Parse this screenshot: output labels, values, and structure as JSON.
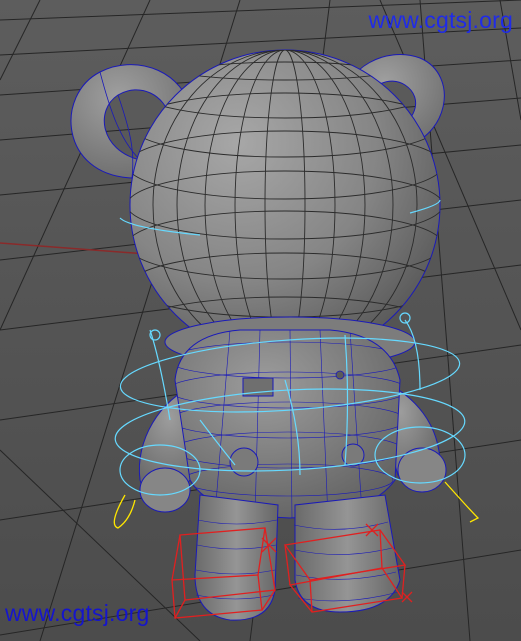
{
  "viewport": {
    "watermark_top": "www.cgtsj.org",
    "watermark_bottom": "www.cgtsj.org"
  },
  "colors": {
    "grid": "#262626",
    "mesh_body": "#8a8a8a",
    "wireframe": "#1a1ab8",
    "nurbs_control": "#66d9ff",
    "ik_handle": "#ffe600",
    "foot_control": "#e02020",
    "x_axis": "#8a2a2a"
  }
}
